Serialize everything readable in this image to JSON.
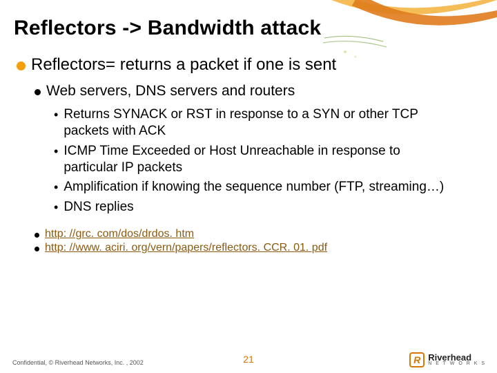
{
  "title": "Reflectors -> Bandwidth attack",
  "lvl1": "Reflectors= returns a packet if one is sent",
  "lvl2": "Web servers, DNS servers and routers",
  "lvl3": [
    "Returns SYNACK or RST in response to a SYN or other TCP packets with ACK",
    "ICMP Time Exceeded or Host Unreachable in response to particular IP packets",
    "Amplification if knowing the sequence number (FTP, streaming…)",
    "DNS replies"
  ],
  "links": [
    "http: //grc. com/dos/drdos. htm",
    "http: //www. aciri. org/vern/papers/reflectors. CCR. 01. pdf"
  ],
  "footer": "Confidential, © Riverhead Networks, Inc. , 2002",
  "page": "21",
  "logo": {
    "name": "Riverhead",
    "sub": "N E T W O R K S"
  }
}
